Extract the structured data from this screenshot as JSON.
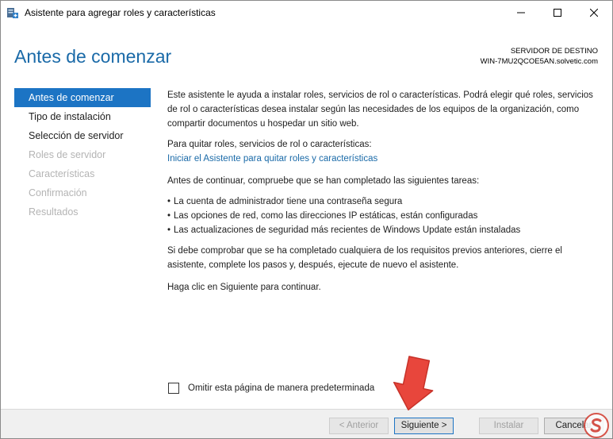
{
  "window": {
    "title": "Asistente para agregar roles y características",
    "icons": {
      "app": "server-wizard-icon",
      "minimize": "minimize-icon",
      "maximize": "maximize-icon",
      "close": "close-icon"
    }
  },
  "header": {
    "title": "Antes de comenzar",
    "destination_label": "SERVIDOR DE DESTINO",
    "destination_server": "WIN-7MU2QCOE5AN.solvetic.com"
  },
  "sidebar": {
    "items": [
      {
        "label": "Antes de comenzar",
        "state": "active"
      },
      {
        "label": "Tipo de instalación",
        "state": "enabled"
      },
      {
        "label": "Selección de servidor",
        "state": "enabled"
      },
      {
        "label": "Roles de servidor",
        "state": "disabled"
      },
      {
        "label": "Características",
        "state": "disabled"
      },
      {
        "label": "Confirmación",
        "state": "disabled"
      },
      {
        "label": "Resultados",
        "state": "disabled"
      }
    ]
  },
  "content": {
    "intro": "Este asistente le ayuda a instalar roles, servicios de rol o características. Podrá elegir qué roles, servicios de rol o características desea instalar según las necesidades de los equipos de la organización, como compartir documentos u hospedar un sitio web.",
    "remove_label": "Para quitar roles, servicios de rol o características:",
    "remove_link": "Iniciar el Asistente para quitar roles y características",
    "before_continue": "Antes de continuar, compruebe que se han completado las siguientes tareas:",
    "tasks": [
      "La cuenta de administrador tiene una contraseña segura",
      "Las opciones de red, como las direcciones IP estáticas, están configuradas",
      "Las actualizaciones de seguridad más recientes de Windows Update están instaladas"
    ],
    "prereq_note": "Si debe comprobar que se ha completado cualquiera de los requisitos previos anteriores, cierre el asistente, complete los pasos y, después, ejecute de nuevo el asistente.",
    "continue_note": "Haga clic en Siguiente para continuar."
  },
  "skip_checkbox": {
    "label": "Omitir esta página de manera predeterminada",
    "checked": false
  },
  "footer": {
    "previous": "< Anterior",
    "next": "Siguiente >",
    "install": "Instalar",
    "cancel": "Cancelar"
  },
  "colors": {
    "accent": "#1c74c4",
    "title": "#1a6aa8",
    "link": "#1a6aa8",
    "arrow": "#e8463c"
  }
}
